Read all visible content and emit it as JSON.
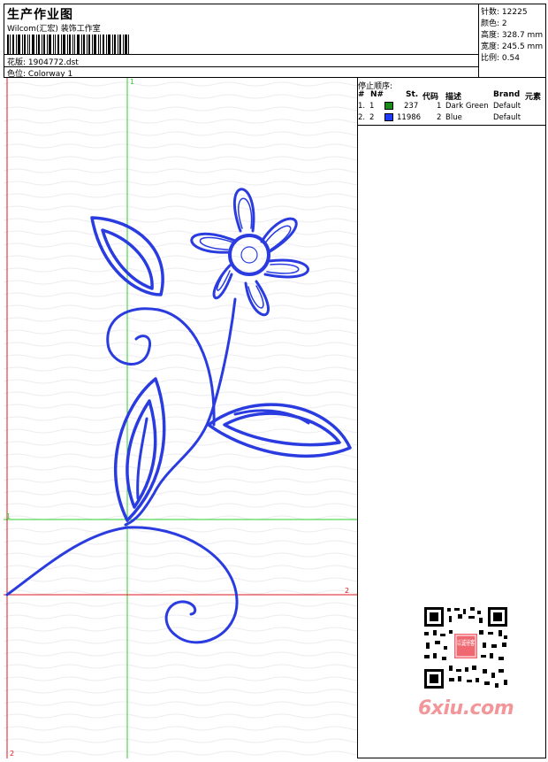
{
  "header": {
    "title": "生产作业图",
    "company": "Wilcom(汇宏) 装饰工作室",
    "filename_label": "花版:",
    "filename": "1904772.dst",
    "colorway_label": "色位:",
    "colorway": "Colorway 1"
  },
  "stats": {
    "stitches_label": "针数:",
    "stitches": "12225",
    "colors_label": "颜色:",
    "colors": "2",
    "height_label": "高度:",
    "height": "328.7 mm",
    "width_label": "宽度:",
    "width": "245.5 mm",
    "ratio_label": "比例:",
    "ratio": "0.54"
  },
  "sequence": {
    "title": "停止顺序:",
    "columns": {
      "hash": "#",
      "no": "N#",
      "st": "St.",
      "code": "代码",
      "desc": "描述",
      "brand": "Brand",
      "element": "元素"
    },
    "rows": [
      {
        "idx": "1.",
        "no": "1",
        "color": "#1a8a1a",
        "st": "237",
        "code": "1",
        "desc": "Dark Green",
        "brand": "Default"
      },
      {
        "idx": "2.",
        "no": "2",
        "color": "#1f3bff",
        "st": "11986",
        "code": "2",
        "desc": "Blue",
        "brand": "Default"
      }
    ]
  },
  "guides": {
    "green_v_label": "1",
    "green_h_label": "1",
    "red_h_label": "2",
    "red_v_label": "2",
    "green_color": "#2ad12a",
    "red_color": "#e0141e"
  },
  "design": {
    "stitch_color": "#2a3ce0"
  },
  "watermark": {
    "text": "6xiu.com",
    "seal_text": "以诚待客"
  }
}
